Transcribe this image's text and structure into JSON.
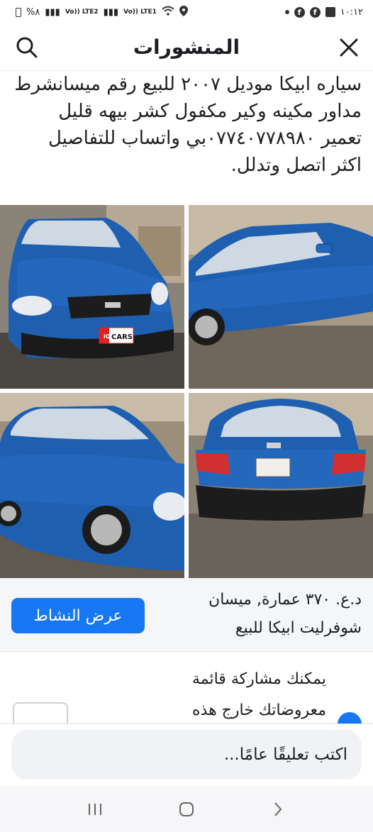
{
  "status_bar": {
    "time": "١٠:١٢",
    "battery": "%٨",
    "sim1": "Vo)) LTE2",
    "sim2": "Vo)) LTE1"
  },
  "header": {
    "title": "المنشورات",
    "close_icon": "close-icon",
    "search_icon": "search-icon"
  },
  "post": {
    "text": "سياره ابيكا موديل ٢٠٠٧ للبيع رقم ميسانشرط مداور مكينه وكير مكفول كشر بيهه قليل تعمير ٠٧٧٤٠٧٧٨٩٨٠بي واتساب للتفاصيل اكثر اتصل وتدلل.",
    "photo_watermark": "iQ CARS",
    "photos": [
      "car-front-view",
      "car-side-view",
      "car-side-angle-view",
      "car-rear-view"
    ]
  },
  "listing": {
    "price_location": "د.ع. ٣٧٠ عمارة, ميسان",
    "title": "شوفرليت ابيكا للبيع",
    "activity_button": "عرض النشاط"
  },
  "share": {
    "line1": "يمكنك مشاركة قائمة",
    "line2": "معروضاتك خارج هذه"
  },
  "comment": {
    "placeholder": "اكتب تعليقًا عامًا..."
  },
  "colors": {
    "accent": "#1877f2",
    "car_blue": "#1f5fb0"
  }
}
